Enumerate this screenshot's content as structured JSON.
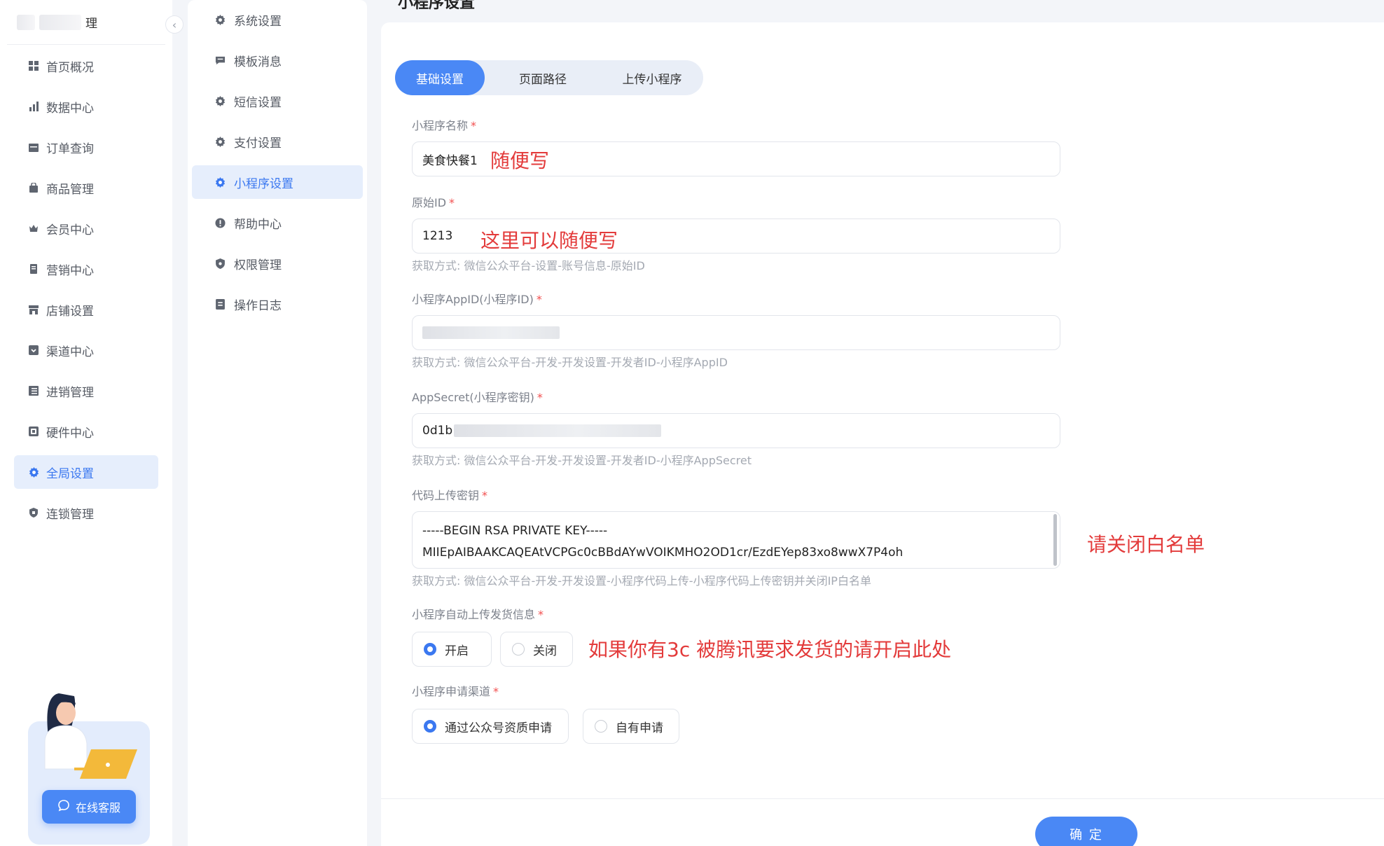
{
  "sidebar": {
    "brand_text": "理",
    "items": [
      {
        "label": "首页概况",
        "icon": "grid-icon"
      },
      {
        "label": "数据中心",
        "icon": "bar-chart-icon"
      },
      {
        "label": "订单查询",
        "icon": "calendar-icon"
      },
      {
        "label": "商品管理",
        "icon": "bag-icon"
      },
      {
        "label": "会员中心",
        "icon": "crown-icon"
      },
      {
        "label": "营销中心",
        "icon": "bookmark-icon"
      },
      {
        "label": "店铺设置",
        "icon": "store-icon"
      },
      {
        "label": "渠道中心",
        "icon": "channel-icon"
      },
      {
        "label": "进销管理",
        "icon": "list-icon"
      },
      {
        "label": "硬件中心",
        "icon": "device-icon"
      },
      {
        "label": "全局设置",
        "icon": "gear-icon",
        "active": true
      },
      {
        "label": "连锁管理",
        "icon": "shield-icon"
      }
    ],
    "support_label": "在线客服"
  },
  "subnav": {
    "items": [
      {
        "label": "系统设置",
        "icon": "gear-icon"
      },
      {
        "label": "模板消息",
        "icon": "message-icon"
      },
      {
        "label": "短信设置",
        "icon": "gear-icon"
      },
      {
        "label": "支付设置",
        "icon": "gear-icon"
      },
      {
        "label": "小程序设置",
        "icon": "gear-icon",
        "active": true
      },
      {
        "label": "帮助中心",
        "icon": "info-icon"
      },
      {
        "label": "权限管理",
        "icon": "shield-icon"
      },
      {
        "label": "操作日志",
        "icon": "document-icon"
      }
    ]
  },
  "main": {
    "page_title": "小程序设置",
    "tabs": [
      "基础设置",
      "页面路径",
      "上传小程序"
    ],
    "fields": {
      "name": {
        "label": "小程序名称",
        "value": "美食快餐1"
      },
      "original_id": {
        "label": "原始ID",
        "value": "1213",
        "hint": "获取方式: 微信公众平台-设置-账号信息-原始ID"
      },
      "appid": {
        "label": "小程序AppID(小程序ID)",
        "hint": "获取方式: 微信公众平台-开发-开发设置-开发者ID-小程序AppID"
      },
      "secret": {
        "label": "AppSecret(小程序密钥)",
        "value_prefix": "0d1b",
        "hint": "获取方式: 微信公众平台-开发-开发设置-开发者ID-小程序AppSecret"
      },
      "upload_key": {
        "label": "代码上传密钥",
        "line1": "-----BEGIN RSA PRIVATE KEY-----",
        "line2": "MIIEpAIBAAKCAQEAtVCPGc0cBBdAYwVOIKMHO2OD1cr/EzdEYep83xo8wwX7P4oh",
        "hint": "获取方式: 微信公众平台-开发-开发设置-小程序代码上传-小程序代码上传密钥并关闭IP白名单"
      },
      "auto_upload": {
        "label": "小程序自动上传发货信息",
        "options": [
          "开启",
          "关闭"
        ],
        "selected": "开启"
      },
      "apply_channel": {
        "label": "小程序申请渠道",
        "options": [
          "通过公众号资质申请",
          "自有申请"
        ],
        "selected": "通过公众号资质申请"
      }
    },
    "annotations": {
      "name": "随便写",
      "original_id": "这里可以随便写",
      "upload_key": "请关闭白名单",
      "auto_upload": "如果你有3c 被腾讯要求发货的请开启此处"
    },
    "confirm_label": "确 定",
    "accent_color": "#4a88f5",
    "required_color": "#f24e4e",
    "annotation_color": "#e33b3b"
  }
}
